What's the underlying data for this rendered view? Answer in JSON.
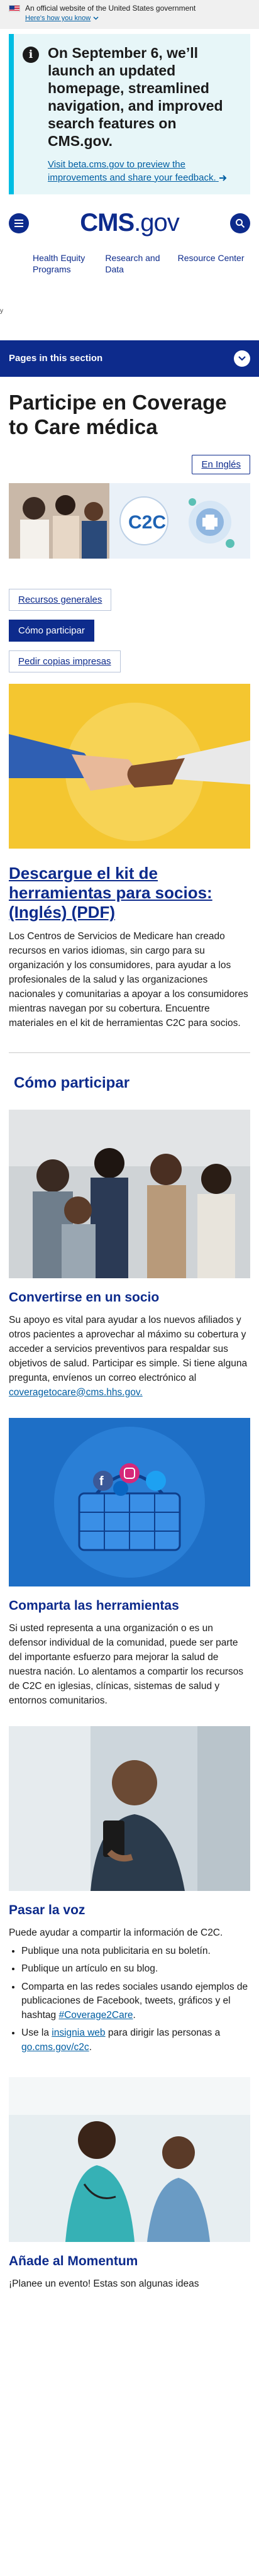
{
  "gov_banner": {
    "text": "An official website of the United States government",
    "link": "Here's how you know"
  },
  "alert": {
    "title": "On September 6, we’ll launch an updated homepage, streamlined navigation, and improved search features on CMS.gov.",
    "link": "Visit beta.cms.gov to preview the improvements and share your feedback."
  },
  "header": {
    "logo_main": "CMS",
    "logo_suffix": ".gov"
  },
  "quick_nav": [
    {
      "label": "Health Equity Programs"
    },
    {
      "label": "Research and Data"
    },
    {
      "label": "Resource Center"
    }
  ],
  "stray_mark": "y",
  "pages_bar": {
    "label": "Pages in this section"
  },
  "page": {
    "title": "Participe en Coverage to Care médica",
    "lang_button": "En Inglés"
  },
  "subnav": [
    {
      "label": "Recursos generales"
    },
    {
      "label": "Cómo participar"
    },
    {
      "label": "Pedir copias impresas"
    }
  ],
  "kit": {
    "title": "Descargue el kit de herramientas para socios: (Inglés) (PDF)",
    "body": "Los Centros de Servicios de Medicare han creado recursos en varios idiomas, sin cargo para su organización y los consumidores, para ayudar a los profesionales de la salud y las organizaciones nacionales y comunitarias a apoyar a los consumidores mientras navegan por su cobertura. Encuentre materiales en el kit de herramientas C2C para socios."
  },
  "how": {
    "heading": "Cómo participar",
    "partner": {
      "title": "Convertirse en un socio",
      "body": "Su apoyo es vital para ayudar a los nuevos afiliados y otros pacientes a aprovechar al máximo su cobertura y acceder a servicios preventivos para respaldar sus objetivos de salud. Participar es simple. Si tiene alguna pregunta, envíenos un correo electrónico al",
      "email": "coveragetocare@cms.hhs.gov."
    },
    "share": {
      "title": "Comparta las herramientas",
      "body": "Si usted representa a una organización o es un defensor individual de la comunidad, puede ser parte del importante esfuerzo para mejorar la salud de nuestra nación. Lo alentamos a compartir los recursos de C2C en iglesias, clínicas, sistemas de salud y entornos comunitarios."
    },
    "word": {
      "title": "Pasar la voz",
      "intro": "Puede ayudar a compartir la información de C2C.",
      "items": [
        "Publique una nota publicitaria en su boletín.",
        "Publique un artículo en su blog.",
        "Comparta en las redes sociales usando ejemplos de publicaciones de Facebook, tweets, gráficos y el hashtag"
      ],
      "hashtag": "#Coverage2Care",
      "badge_pre": "Use la",
      "badge_link": "insignia web",
      "badge_mid": "para dirigir las personas a",
      "badge_url": "go.cms.gov/c2c"
    },
    "event": {
      "title": "Añade al Momentum",
      "body": "¡Planee un evento! Estas son algunas ideas"
    }
  },
  "colors": {
    "brand": "#0d2b8c",
    "link": "#005ea2",
    "alert_bg": "#e7f6f8",
    "alert_border": "#00bde3"
  }
}
